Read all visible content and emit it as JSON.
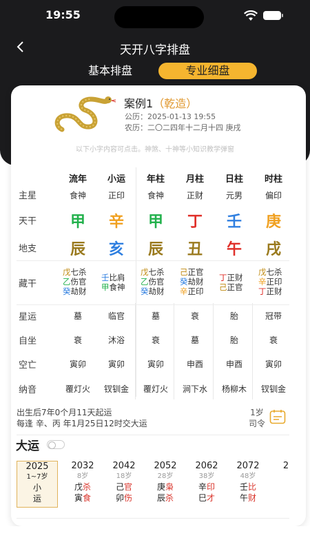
{
  "status": {
    "time": "19:55"
  },
  "header": {
    "title": "天开八字排盘",
    "tab_basic": "基本排盘",
    "tab_pro": "专业细盘"
  },
  "case": {
    "name": "案例1",
    "gender": "（乾造）",
    "solar": "公历：2025-01-13 19:55",
    "lunar": "农历：二〇二四年十二月十四 庚戌"
  },
  "hint": "以下小字内容可点击。神煞、十神等小知识教学弹窗",
  "columns": [
    "流年",
    "小运",
    "年柱",
    "月柱",
    "日柱",
    "时柱"
  ],
  "row_labels": [
    "主星",
    "天干",
    "地支",
    "藏干",
    "星运",
    "自坐",
    "空亡",
    "纳音"
  ],
  "main_star": [
    "食神",
    "正印",
    "食神",
    "正财",
    "元男",
    "偏印"
  ],
  "tiangan": [
    {
      "char": "甲",
      "color": "#22b14c"
    },
    {
      "char": "辛",
      "color": "#f0a020"
    },
    {
      "char": "甲",
      "color": "#22b14c"
    },
    {
      "char": "丁",
      "color": "#e0302a"
    },
    {
      "char": "壬",
      "color": "#2f7fe0"
    },
    {
      "char": "庚",
      "color": "#f0a020"
    }
  ],
  "dizhi": [
    {
      "char": "辰",
      "color": "#9a7a1e"
    },
    {
      "char": "亥",
      "color": "#2f7fe0"
    },
    {
      "char": "辰",
      "color": "#9a7a1e"
    },
    {
      "char": "丑",
      "color": "#9a7a1e"
    },
    {
      "char": "午",
      "color": "#e0302a"
    },
    {
      "char": "戌",
      "color": "#9a7a1e"
    }
  ],
  "canggan": [
    [
      {
        "g": "戊",
        "gc": "#c08a10",
        "s": "七杀"
      },
      {
        "g": "乙",
        "gc": "#22b14c",
        "s": "伤官"
      },
      {
        "g": "癸",
        "gc": "#2f7fe0",
        "s": "劫财"
      }
    ],
    [
      {
        "g": "壬",
        "gc": "#2f7fe0",
        "s": "比肩"
      },
      {
        "g": "甲",
        "gc": "#22b14c",
        "s": "食神"
      }
    ],
    [
      {
        "g": "戊",
        "gc": "#c08a10",
        "s": "七杀"
      },
      {
        "g": "乙",
        "gc": "#22b14c",
        "s": "伤官"
      },
      {
        "g": "癸",
        "gc": "#2f7fe0",
        "s": "劫财"
      }
    ],
    [
      {
        "g": "己",
        "gc": "#c08a10",
        "s": "正官"
      },
      {
        "g": "癸",
        "gc": "#2f7fe0",
        "s": "劫财"
      },
      {
        "g": "辛",
        "gc": "#f0a020",
        "s": "正印"
      }
    ],
    [
      {
        "g": "丁",
        "gc": "#e0302a",
        "s": "正财"
      },
      {
        "g": "己",
        "gc": "#c08a10",
        "s": "正官"
      }
    ],
    [
      {
        "g": "戊",
        "gc": "#c08a10",
        "s": "七杀"
      },
      {
        "g": "辛",
        "gc": "#f0a020",
        "s": "正印"
      },
      {
        "g": "丁",
        "gc": "#e0302a",
        "s": "正财"
      }
    ]
  ],
  "xingyun": [
    "墓",
    "临官",
    "墓",
    "衰",
    "胎",
    "冠带"
  ],
  "zizuo": [
    "衰",
    "沐浴",
    "衰",
    "墓",
    "胎",
    "衰"
  ],
  "kongwang": [
    "寅卯",
    "寅卯",
    "寅卯",
    "申酉",
    "申酉",
    "寅卯"
  ],
  "nayin": [
    "覆灯火",
    "钗钏金",
    "覆灯火",
    "涧下水",
    "杨柳木",
    "钗钏金"
  ],
  "qiyun": {
    "line1": "出生后7年0个月11天起运",
    "line2": "每逢 辛、丙 年1月25日12时交大运",
    "age": "1岁",
    "siling": "司令"
  },
  "dayun": {
    "title": "大运",
    "first": {
      "year": "2025",
      "age": "1~7岁",
      "l1": "小",
      "l2": "运"
    },
    "items": [
      {
        "year": "2032",
        "age": "8岁",
        "g1": "戊",
        "s1": "杀",
        "g2": "寅",
        "s2": "食"
      },
      {
        "year": "2042",
        "age": "18岁",
        "g1": "己",
        "s1": "官",
        "g2": "卯",
        "s2": "伤"
      },
      {
        "year": "2052",
        "age": "28岁",
        "g1": "庚",
        "s1": "枭",
        "g2": "辰",
        "s2": "杀"
      },
      {
        "year": "2062",
        "age": "38岁",
        "g1": "辛",
        "s1": "印",
        "g2": "巳",
        "s2": "才"
      },
      {
        "year": "2072",
        "age": "48岁",
        "g1": "壬",
        "s1": "比",
        "g2": "午",
        "s2": "财"
      }
    ]
  }
}
